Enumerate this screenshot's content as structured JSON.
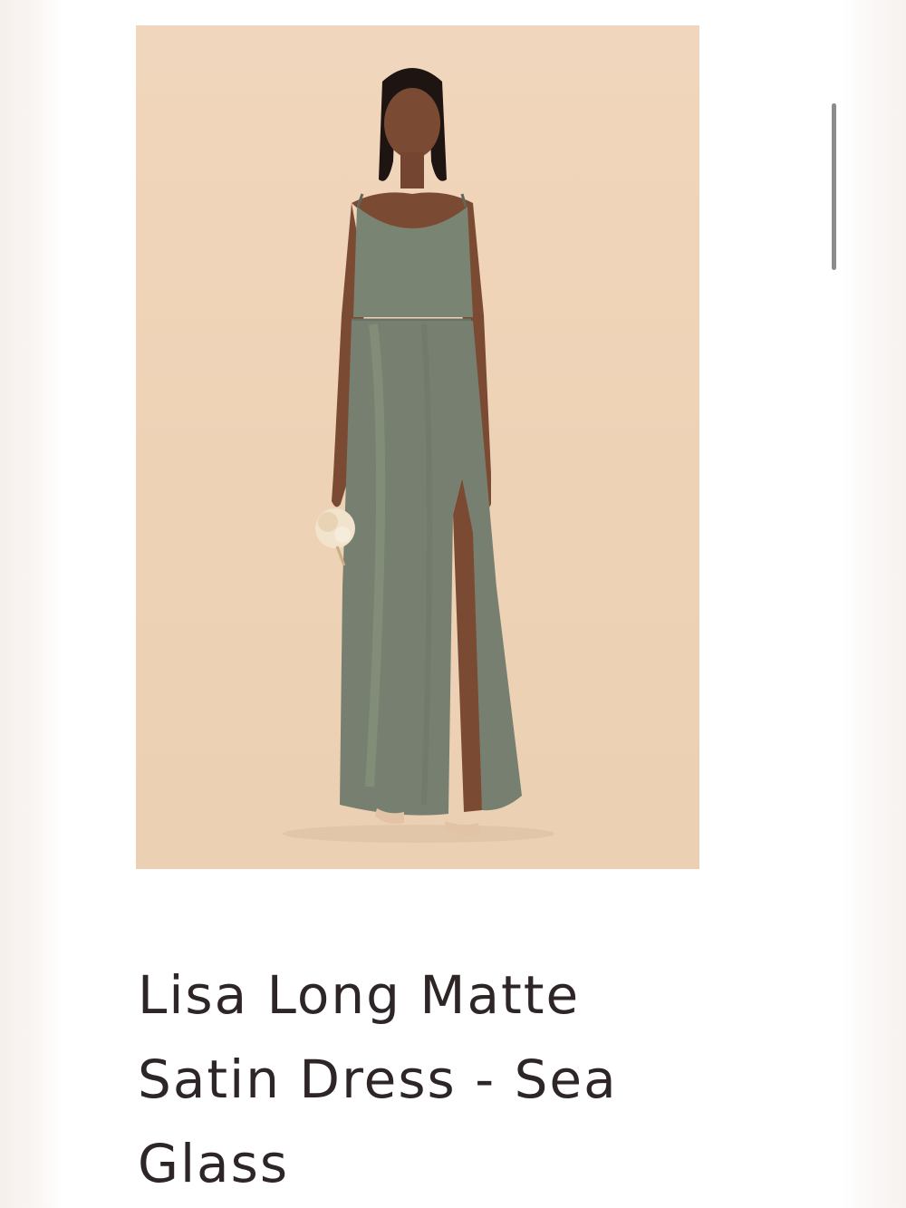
{
  "product": {
    "title": "Lisa Long Matte Satin Dress - Sea Glass",
    "image_alt": "Lisa Long Matte Satin Dress - Sea Glass",
    "image_background_color": "#efd4b9",
    "dress_color": "#77806f"
  },
  "scrollbar": {
    "icon": "vertical-scrollbar"
  }
}
